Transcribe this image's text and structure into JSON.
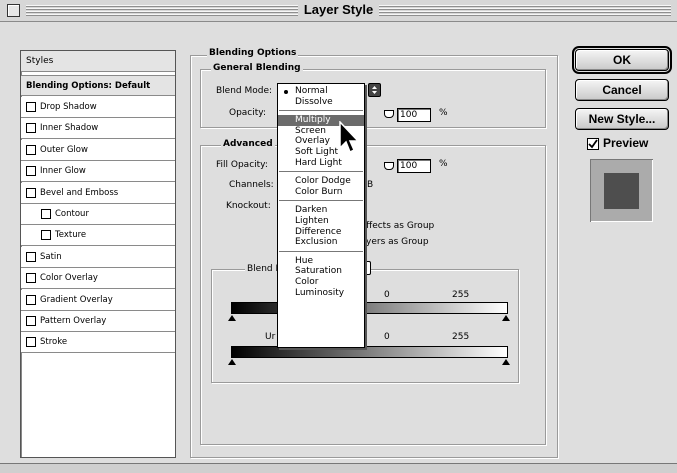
{
  "window": {
    "title": "Layer Style"
  },
  "styles_panel": {
    "header": "Styles",
    "selected": "Blending Options: Default",
    "items": [
      {
        "label": "Drop Shadow",
        "indent": false
      },
      {
        "label": "Inner Shadow",
        "indent": false
      },
      {
        "label": "Outer Glow",
        "indent": false
      },
      {
        "label": "Inner Glow",
        "indent": false
      },
      {
        "label": "Bevel and Emboss",
        "indent": false
      },
      {
        "label": "Contour",
        "indent": true
      },
      {
        "label": "Texture",
        "indent": true
      },
      {
        "label": "Satin",
        "indent": false
      },
      {
        "label": "Color Overlay",
        "indent": false
      },
      {
        "label": "Gradient Overlay",
        "indent": false
      },
      {
        "label": "Pattern Overlay",
        "indent": false
      },
      {
        "label": "Stroke",
        "indent": false
      }
    ]
  },
  "blending": {
    "legend": "Blending Options",
    "general_legend": "General Blending",
    "blend_mode_label": "Blend Mode:",
    "opacity_label": "Opacity:",
    "opacity_value": "100",
    "opacity_unit": "%",
    "advanced_legend": "Advanced",
    "fill_opacity_label": "Fill Opacity:",
    "fill_opacity_value": "100",
    "fill_opacity_unit": "%",
    "channels_label": "Channels:",
    "channels_partial": "B",
    "knockout_label": "Knockout:",
    "effects_group_partial": "ffects as Group",
    "layers_group_partial": "yers as Group",
    "blend_if_partial": "Blend I",
    "this_layer_low": "0",
    "this_layer_high": "255",
    "underlying_partial": "Ur",
    "underlying_low": "0",
    "underlying_high": "255"
  },
  "blend_menu": {
    "selected": "Normal",
    "highlighted": "Multiply",
    "groups": [
      [
        "Normal",
        "Dissolve"
      ],
      [
        "Multiply",
        "Screen",
        "Overlay",
        "Soft Light",
        "Hard Light"
      ],
      [
        "Color Dodge",
        "Color Burn"
      ],
      [
        "Darken",
        "Lighten",
        "Difference",
        "Exclusion"
      ],
      [
        "Hue",
        "Saturation",
        "Color",
        "Luminosity"
      ]
    ]
  },
  "buttons": {
    "ok": "OK",
    "cancel": "Cancel",
    "new_style": "New Style...",
    "preview": "Preview"
  },
  "preview_checked": true,
  "colors": {
    "preview_swatch": "#4e4e4e",
    "menu_highlight": "#6b6b6b",
    "dialog_bg": "#dedede"
  }
}
